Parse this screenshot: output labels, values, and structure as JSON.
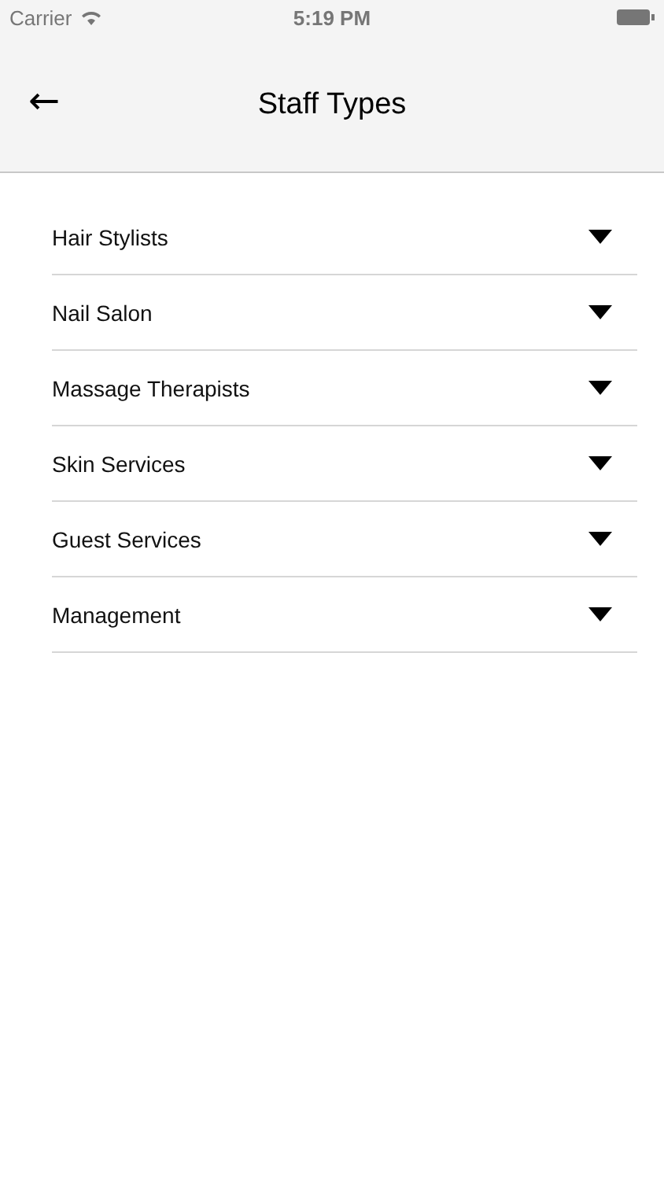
{
  "status_bar": {
    "carrier": "Carrier",
    "time": "5:19 PM"
  },
  "header": {
    "back": "←",
    "title": "Staff Types"
  },
  "staff_types": [
    {
      "label": "Hair Stylists"
    },
    {
      "label": "Nail Salon"
    },
    {
      "label": "Massage Therapists"
    },
    {
      "label": "Skin Services"
    },
    {
      "label": "Guest Services"
    },
    {
      "label": "Management"
    }
  ]
}
